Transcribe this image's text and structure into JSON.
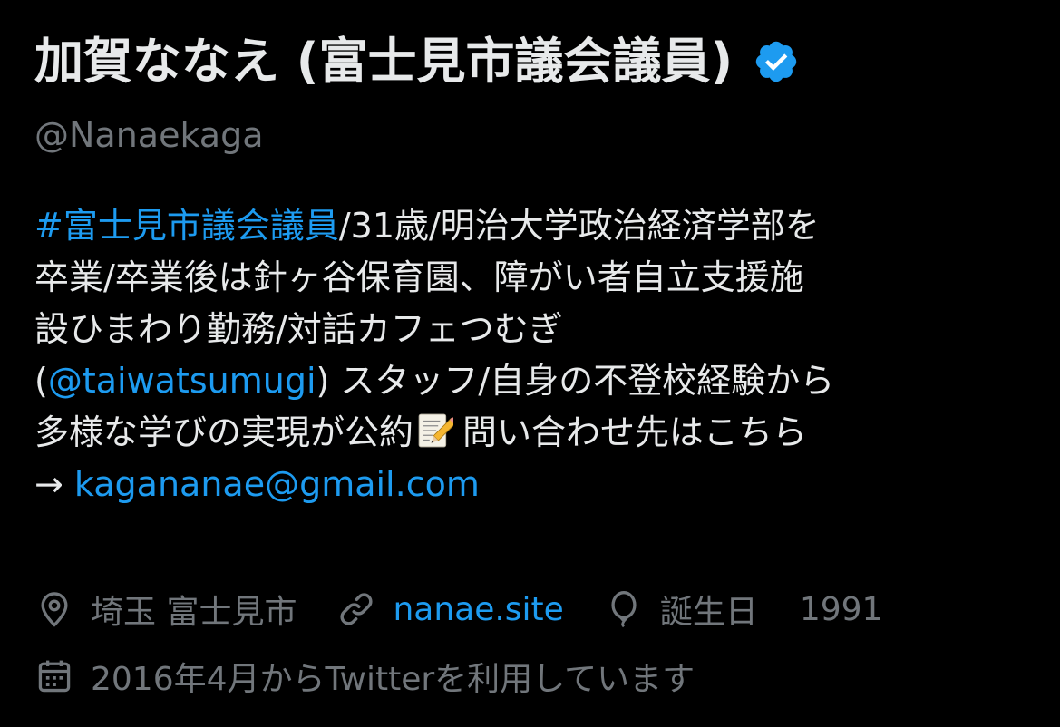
{
  "profile": {
    "display_name": "加賀ななえ (富士見市議会議員)",
    "verified_icon": "verified-badge-icon",
    "handle": "@Nanaekaga"
  },
  "bio": {
    "line1_hashtag": "#富士見市議会議員",
    "line1_rest": "/31歳/明治大学政治経済学部を",
    "line2": "卒業/卒業後は針ヶ谷保育園、障がい者自立支援施",
    "line3": "設ひまわり勤務/対話カフェつむぎ",
    "line4_open": "(",
    "line4_mention": "@taiwatsumugi",
    "line4_rest": ") スタッフ/自身の不登校経験から",
    "line5_text": "多様な学びの実現が公約",
    "line5_emoji": "memo-emoji",
    "line5_rest": "問い合わせ先はこちら",
    "line6_arrow": "→ ",
    "line6_email": "kagananae@gmail.com"
  },
  "meta": {
    "location_icon": "location-pin-icon",
    "location": "埼玉 富士見市",
    "link_icon": "link-icon",
    "website": "nanae.site",
    "birthday_icon": "balloon-icon",
    "birthday_label": "誕生日",
    "birthday_year": "1991",
    "joined_icon": "calendar-icon",
    "joined": "2016年4月からTwitterを利用しています"
  },
  "colors": {
    "background": "#000000",
    "primary_text": "#e7e9ea",
    "secondary_text": "#71767b",
    "link": "#1d9bf0",
    "verified": "#1d9bf0"
  }
}
